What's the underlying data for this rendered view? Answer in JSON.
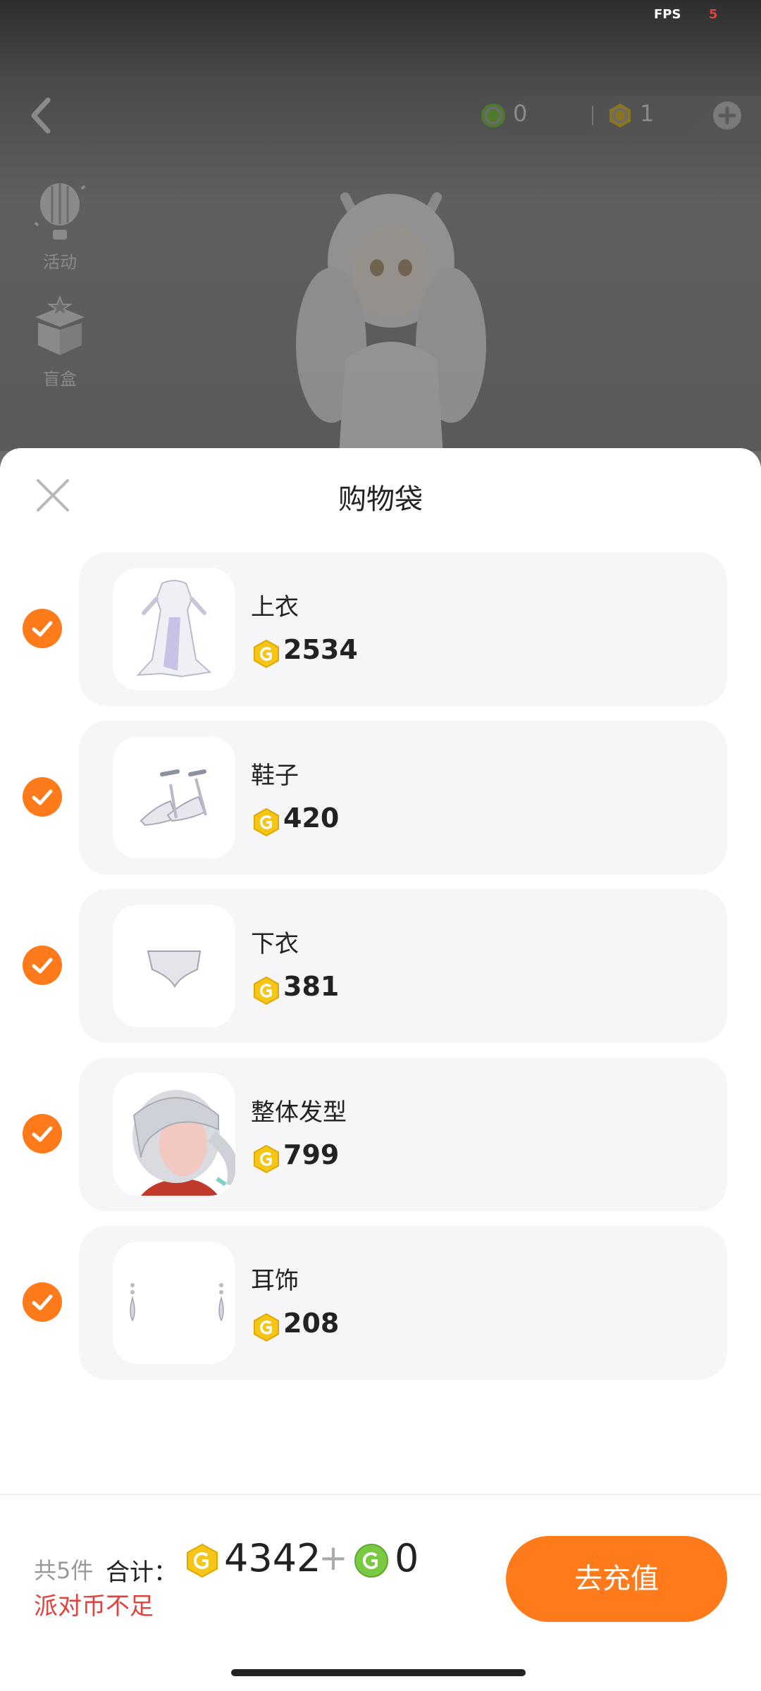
{
  "status": {
    "fps_label": "FPS",
    "fps_value": "5"
  },
  "top_bar": {
    "currency_green": "0",
    "currency_gold": "1"
  },
  "side_menu": [
    {
      "label": "活动",
      "icon": "hot-air-balloon-icon"
    },
    {
      "label": "盲盒",
      "icon": "gift-box-icon"
    }
  ],
  "sheet": {
    "title": "购物袋",
    "items": [
      {
        "name": "上衣",
        "price": "2534",
        "icon": "dress-icon",
        "checked": true
      },
      {
        "name": "鞋子",
        "price": "420",
        "icon": "shoes-icon",
        "checked": true
      },
      {
        "name": "下衣",
        "price": "381",
        "icon": "underwear-icon",
        "checked": true
      },
      {
        "name": "整体发型",
        "price": "799",
        "icon": "hairstyle-icon",
        "checked": true
      },
      {
        "name": "耳饰",
        "price": "208",
        "icon": "earrings-icon",
        "checked": true
      }
    ]
  },
  "footer": {
    "count_text": "共5件",
    "total_label": "合计：",
    "gold_total": "4342",
    "plus": "+",
    "green_total": "0",
    "warning": "派对币不足",
    "recharge_label": "去充值"
  },
  "colors": {
    "accent": "#ff7a1a",
    "warning": "#e0433d",
    "gold_coin": "#f5c518",
    "green_coin": "#7ac943"
  }
}
